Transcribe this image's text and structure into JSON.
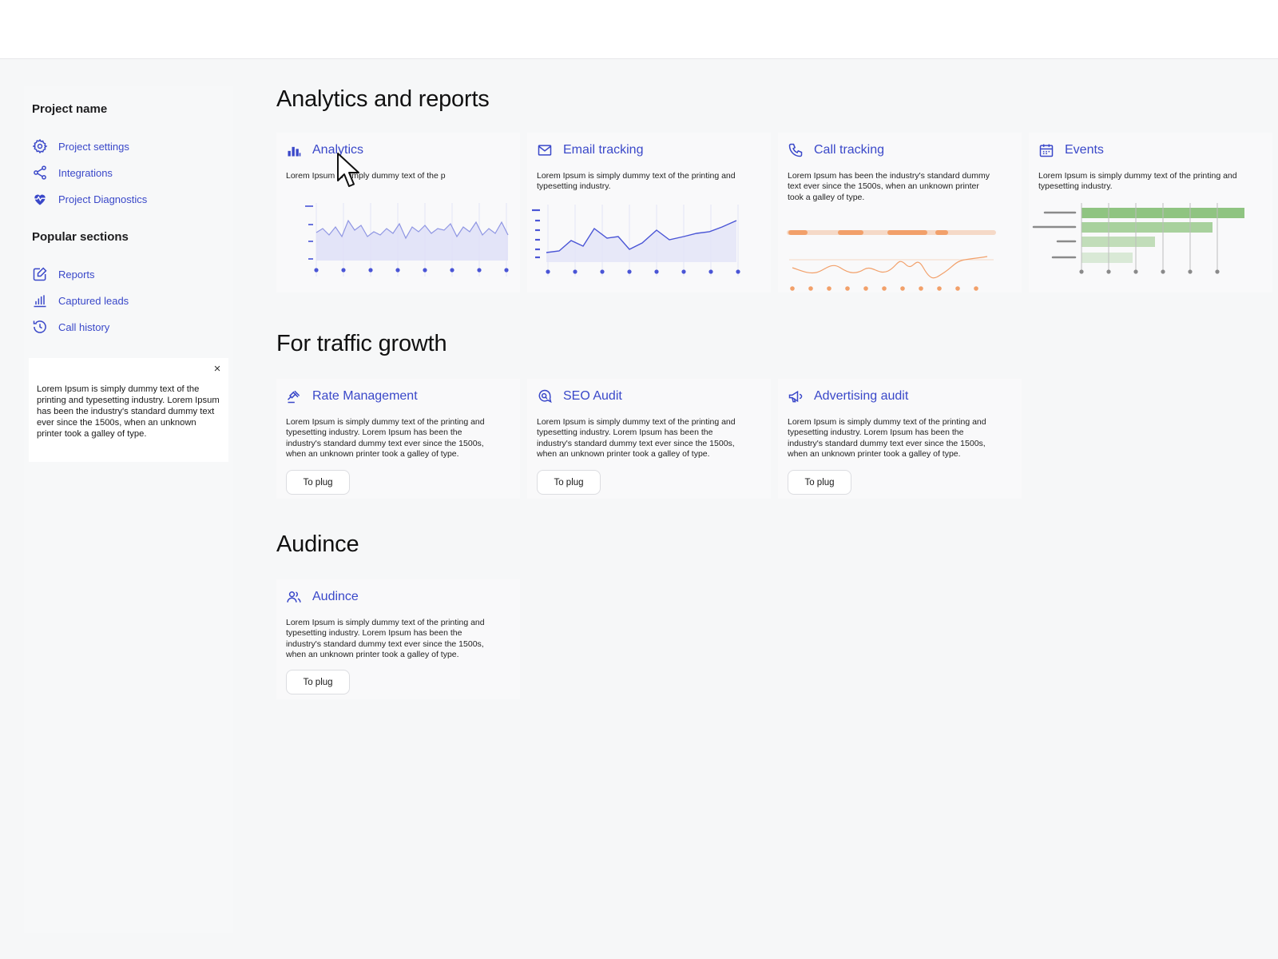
{
  "sidebar": {
    "project_heading": "Project name",
    "project_items": [
      {
        "label": "Project settings",
        "icon": "gear-icon"
      },
      {
        "label": "Integrations",
        "icon": "share-nodes-icon"
      },
      {
        "label": "Project Diagnostics",
        "icon": "heart-pulse-icon"
      }
    ],
    "popular_heading": "Popular sections",
    "popular_items": [
      {
        "label": "Reports",
        "icon": "report-edit-icon"
      },
      {
        "label": "Captured leads",
        "icon": "bar-chart-icon"
      },
      {
        "label": "Call history",
        "icon": "history-icon"
      }
    ],
    "note": {
      "text": "Lorem Ipsum is simply dummy text of the printing and typesetting industry. Lorem Ipsum has been the industry's standard dummy text ever since the 1500s, when an unknown printer took a galley of type.",
      "close_label": "×"
    }
  },
  "sections": {
    "analytics": {
      "title": "Analytics and reports",
      "cards": [
        {
          "title": "Analytics",
          "icon": "bar-chart-icon",
          "desc": "Lorem Ipsum is simply dummy text of the p"
        },
        {
          "title": "Email tracking",
          "icon": "mail-icon",
          "desc": "Lorem Ipsum is simply dummy text of the printing and typesetting industry."
        },
        {
          "title": "Call tracking",
          "icon": "phone-icon",
          "desc": "Lorem Ipsum has been the industry's standard dummy text ever since the 1500s, when an unknown printer took a galley of type."
        },
        {
          "title": "Events",
          "icon": "calendar-icon",
          "desc": "Lorem Ipsum is simply dummy text of the printing and typesetting industry."
        }
      ]
    },
    "traffic": {
      "title": "For traffic growth",
      "cards": [
        {
          "title": "Rate Management",
          "icon": "gavel-icon",
          "desc": "Lorem Ipsum is simply dummy text of the printing and typesetting industry. Lorem Ipsum has been the industry's standard dummy text ever since the 1500s, when an unknown printer took a galley of type.",
          "button": "To plug"
        },
        {
          "title": "SEO Audit",
          "icon": "search-chat-icon",
          "desc": "Lorem Ipsum is simply dummy text of the printing and typesetting industry. Lorem Ipsum has been the industry's standard dummy text ever since the 1500s, when an unknown printer took a galley of type.",
          "button": "To plug"
        },
        {
          "title": "Advertising audit",
          "icon": "megaphone-icon",
          "desc": "Lorem Ipsum is simply dummy text of the printing and typesetting industry. Lorem Ipsum has been the industry's standard dummy text ever since the 1500s, when an unknown printer took a galley of type.",
          "button": "To plug"
        }
      ]
    },
    "audience": {
      "title": "Audince",
      "cards": [
        {
          "title": "Audince",
          "icon": "users-icon",
          "desc": "Lorem Ipsum is simply dummy text of the printing and typesetting industry. Lorem Ipsum has been the industry's standard dummy text ever since the 1500s, when an unknown printer took a galley of type.",
          "button": "To plug"
        }
      ]
    }
  },
  "colors": {
    "accent": "#3a48c9",
    "chart_blue": "#4a55d6",
    "chart_orange": "#f2a06a",
    "chart_green": "#7dbb6b",
    "chart_gray": "#8a8a8a",
    "background": "#f6f7f8"
  },
  "cursor_icon": "mouse-pointer-icon"
}
